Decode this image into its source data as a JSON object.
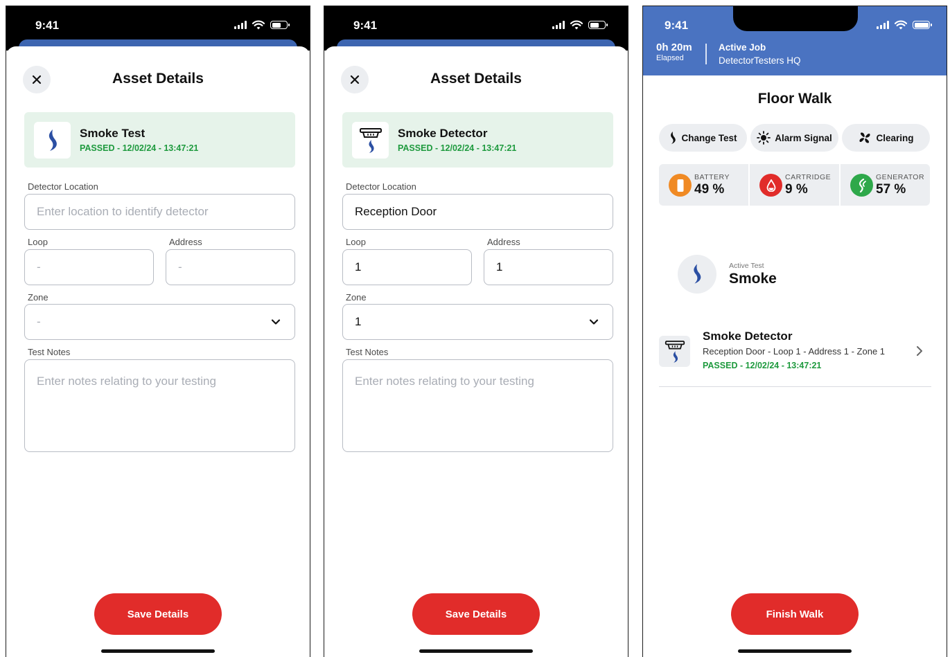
{
  "status_bar": {
    "time": "9:41"
  },
  "screen1": {
    "title": "Asset Details",
    "card": {
      "name": "Smoke Test",
      "status": "PASSED - 12/02/24 - 13:47:21"
    },
    "location": {
      "label": "Detector Location",
      "placeholder": "Enter location to identify detector"
    },
    "loop": {
      "label": "Loop",
      "value": "-"
    },
    "address": {
      "label": "Address",
      "value": "-"
    },
    "zone": {
      "label": "Zone",
      "value": "-"
    },
    "notes": {
      "label": "Test Notes",
      "placeholder": "Enter notes relating to your testing"
    },
    "save_label": "Save Details"
  },
  "screen2": {
    "title": "Asset Details",
    "card": {
      "name": "Smoke Detector",
      "status": "PASSED - 12/02/24 - 13:47:21"
    },
    "location": {
      "label": "Detector Location",
      "value": "Reception Door"
    },
    "loop": {
      "label": "Loop",
      "value": "1"
    },
    "address": {
      "label": "Address",
      "value": "1"
    },
    "zone": {
      "label": "Zone",
      "value": "1"
    },
    "notes": {
      "label": "Test Notes",
      "placeholder": "Enter notes relating to your testing"
    },
    "save_label": "Save Details"
  },
  "screen3": {
    "elapsed": {
      "value": "0h 20m",
      "label": "Elapsed"
    },
    "job": {
      "label": "Active Job",
      "name": "DetectorTesters HQ"
    },
    "title": "Floor Walk",
    "chips": [
      {
        "label": "Change Test",
        "icon": "flame-icon"
      },
      {
        "label": "Alarm Signal",
        "icon": "sun-icon"
      },
      {
        "label": "Clearing",
        "icon": "fan-icon"
      }
    ],
    "meters": [
      {
        "label": "BATTERY",
        "value": "49 %",
        "color": "#f08a24"
      },
      {
        "label": "CARTRIDGE",
        "value": "9 %",
        "color": "#e12c2a"
      },
      {
        "label": "GENERATOR",
        "value": "57 %",
        "color": "#2ea84a"
      }
    ],
    "active_test": {
      "label": "Active Test",
      "value": "Smoke"
    },
    "asset": {
      "name": "Smoke Detector",
      "location": "Reception Door  - Loop 1  - Address 1  - Zone 1",
      "status": "PASSED - 12/02/24 - 13:47:21"
    },
    "finish_label": "Finish Walk"
  },
  "colors": {
    "brand_blue": "#4a73c1",
    "smoke_blue": "#2b4fa3",
    "pass_green": "#1e9a3e",
    "button_red": "#e12c2a"
  }
}
